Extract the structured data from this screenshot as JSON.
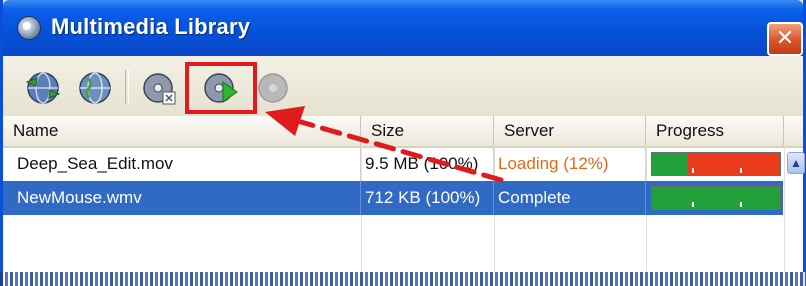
{
  "window": {
    "title": "Multimedia Library",
    "close_symbol": "✕"
  },
  "toolbar": {
    "buttons": [
      {
        "icon": "refresh-globe-icon",
        "enabled": true
      },
      {
        "icon": "globe-icon",
        "enabled": true
      },
      {
        "icon": "disc-delete-icon",
        "enabled": true
      },
      {
        "icon": "disc-play-icon",
        "enabled": true,
        "highlighted": true
      },
      {
        "icon": "disc-stop-icon",
        "enabled": false
      }
    ]
  },
  "table": {
    "headers": [
      "Name",
      "Size",
      "Server",
      "Progress"
    ],
    "rows": [
      {
        "name": "Deep_Sea_Edit.mov",
        "size": "9.5 MB (100%)",
        "server": "Loading (12%)",
        "progress": 0.28,
        "selected": false
      },
      {
        "name": "NewMouse.wmv",
        "size": "712 KB (100%)",
        "server": "Complete",
        "progress": 1.0,
        "selected": true
      }
    ]
  },
  "colors": {
    "annotation_red": "#e01b1b",
    "progress_green": "#22a03a",
    "progress_red": "#ea3b1d",
    "selection_blue": "#316ac5",
    "loading_text": "#e06a1a"
  }
}
